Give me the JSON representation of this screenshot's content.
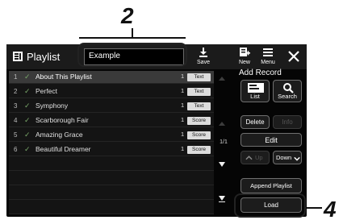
{
  "callouts": {
    "top": "2",
    "right": "4"
  },
  "titlebar": {
    "title": "Playlist",
    "playlist_name": "Example",
    "save_label": "Save",
    "new_label": "New",
    "menu_label": "Menu"
  },
  "rows": [
    {
      "num": "1",
      "check": "✓",
      "name": "About This Playlist",
      "count": "1",
      "type": "Text"
    },
    {
      "num": "2",
      "check": "✓",
      "name": "Perfect",
      "count": "1",
      "type": "Text"
    },
    {
      "num": "3",
      "check": "✓",
      "name": "Symphony",
      "count": "1",
      "type": "Text"
    },
    {
      "num": "4",
      "check": "✓",
      "name": "Scarborough Fair",
      "count": "1",
      "type": "Score"
    },
    {
      "num": "5",
      "check": "✓",
      "name": "Amazing Grace",
      "count": "1",
      "type": "Score"
    },
    {
      "num": "6",
      "check": "✓",
      "name": "Beautiful Dreamer",
      "count": "1",
      "type": "Score"
    }
  ],
  "pager": {
    "page": "1/1"
  },
  "side": {
    "add_record": "Add Record",
    "list": "List",
    "search": "Search",
    "delete": "Delete",
    "info": "Info",
    "edit": "Edit",
    "up": "Up",
    "down": "Down",
    "append": "Append Playlist",
    "load": "Load"
  },
  "colors": {
    "screen_bg": "#050505",
    "selected_row": "#3a3a3a",
    "check_green": "#79a86a"
  }
}
